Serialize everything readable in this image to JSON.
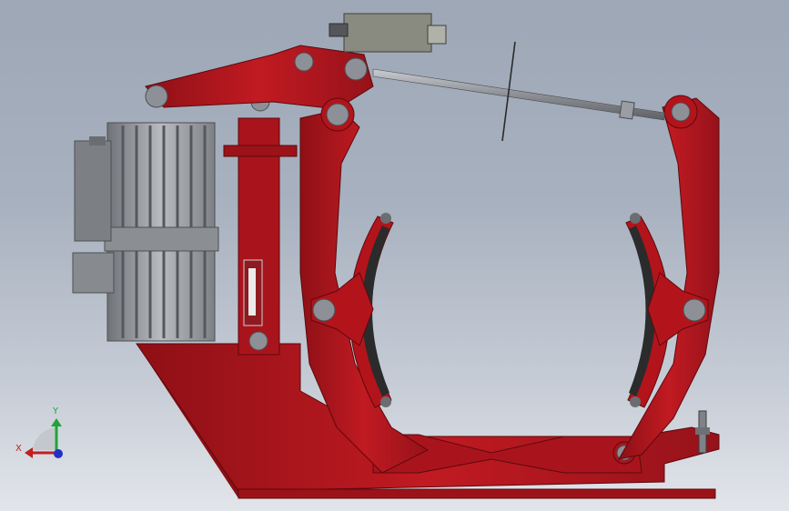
{
  "viewport": {
    "background_top": "#9da7b6",
    "background_bottom": "#e2e5ea"
  },
  "model": {
    "frame_color": "#b3141b",
    "frame_shadow": "#7e0d12",
    "pin_color": "#8d9096",
    "motor_color": "#9ea2a6",
    "lining_color": "#2b2b2b",
    "rod_color": "#8f9297"
  },
  "triad": {
    "x_label": "X",
    "y_label": "Y",
    "x_color": "#c0201e",
    "y_color": "#22a33a",
    "z_color": "#2230c4"
  }
}
